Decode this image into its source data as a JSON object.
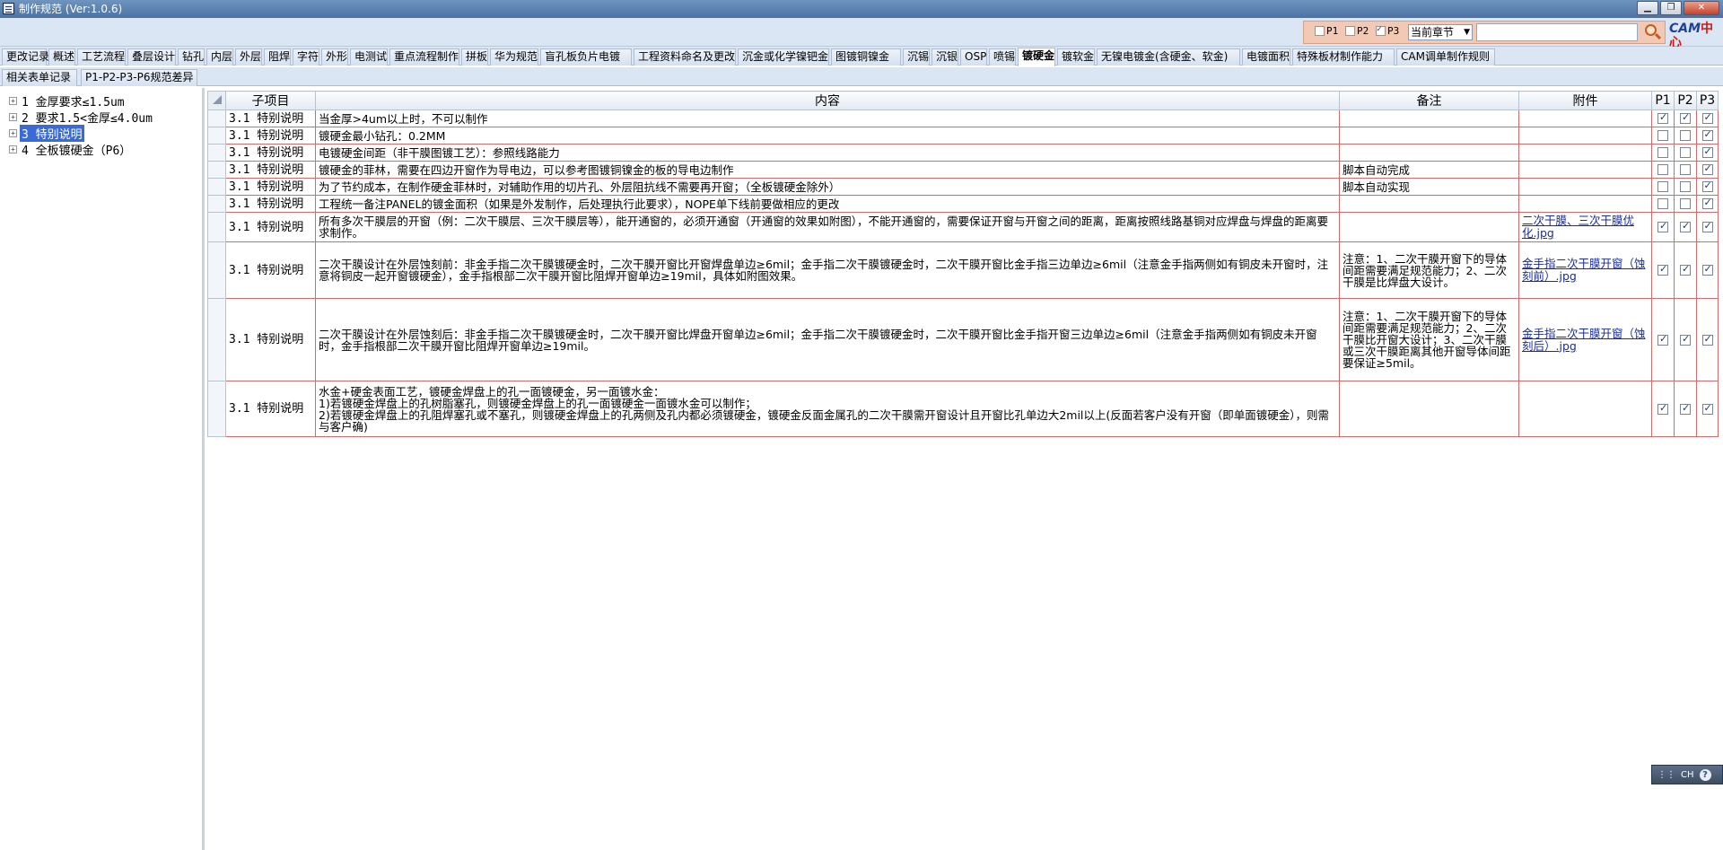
{
  "window": {
    "title": "制作规范 (Ver:1.0.6)"
  },
  "search": {
    "p1_label": "P1",
    "p2_label": "P2",
    "p3_label": "P3",
    "p1_checked": false,
    "p2_checked": false,
    "p3_checked": true,
    "scope_value": "当前章节",
    "query": "",
    "logo_latin": "CAM",
    "logo_zh": "中心"
  },
  "tabs_row1": [
    "更改记录",
    "概述",
    "工艺流程",
    "叠层设计",
    "钻孔",
    "内层",
    "外层",
    "阻焊",
    "字符",
    "外形",
    "电测试",
    "重点流程制作",
    "拼板",
    "华为规范",
    "盲孔板负片电镀",
    "工程资料命名及更改",
    "沉金或化学镍钯金",
    "图镀铜镍金",
    "沉锡",
    "沉银",
    "OSP",
    "喷锡",
    "镀硬金",
    "镀软金",
    "无镍电镀金(含硬金、软金)",
    "电镀面积",
    "特殊板材制作能力",
    "CAM调单制作规则"
  ],
  "active_tab": "镀硬金",
  "tabs_row2": [
    "相关表单记录",
    "P1-P2-P3-P6规范差异"
  ],
  "tree": [
    {
      "label": "1 金厚要求≤1.5um"
    },
    {
      "label": "2 要求1.5<金厚≤4.0um"
    },
    {
      "label": "3 特别说明"
    },
    {
      "label": "4 全板镀硬金（P6）"
    }
  ],
  "selected_tree_index": 2,
  "grid": {
    "headers": {
      "sub": "子项目",
      "content": "内容",
      "note": "备注",
      "attach": "附件",
      "p1": "P1",
      "p2": "P2",
      "p3": "P3"
    },
    "rows": [
      {
        "sub": "3.1 特别说明",
        "content": "当金厚>4um以上时，不可以制作",
        "note": "",
        "attach": "",
        "p1": true,
        "p2": true,
        "p3": true
      },
      {
        "sub": "3.1 特别说明",
        "content": "镀硬金最小钻孔：0.2MM",
        "note": "",
        "attach": "",
        "p1": false,
        "p2": false,
        "p3": true
      },
      {
        "sub": "3.1 特别说明",
        "content": "电镀硬金间距（非干膜图镀工艺）：参照线路能力",
        "note": "",
        "attach": "",
        "p1": false,
        "p2": false,
        "p3": true
      },
      {
        "sub": "3.1 特别说明",
        "content": "镀硬金的菲林，需要在四边开窗作为导电边，可以参考图镀铜镍金的板的导电边制作",
        "note": "脚本自动完成",
        "attach": "",
        "p1": false,
        "p2": false,
        "p3": true
      },
      {
        "sub": "3.1 特别说明",
        "content": "为了节约成本，在制作硬金菲林时，对辅助作用的切片孔、外层阻抗线不需要再开窗；（全板镀硬金除外）",
        "note": "脚本自动实现",
        "attach": "",
        "p1": false,
        "p2": false,
        "p3": true
      },
      {
        "sub": "3.1 特别说明",
        "content": "工程统一备注PANEL的镀金面积（如果是外发制作，后处理执行此要求），NOPE单下线前要做相应的更改",
        "note": "",
        "attach": "",
        "p1": false,
        "p2": false,
        "p3": true
      },
      {
        "sub": "3.1 特别说明",
        "content": "所有多次干膜层的开窗（例：二次干膜层、三次干膜层等），能开通窗的，必须开通窗（开通窗的效果如附图），不能开通窗的，需要保证开窗与开窗之间的距离，距离按照线路基铜对应焊盘与焊盘的距离要求制作。",
        "note": "",
        "attach": "二次干膜、三次干膜优化.jpg",
        "p1": true,
        "p2": true,
        "p3": true
      },
      {
        "sub": "3.1 特别说明",
        "content": "二次干膜设计在外层蚀刻前：非金手指二次干膜镀硬金时，二次干膜开窗比开窗焊盘单边≥6mil；金手指二次干膜镀硬金时，二次干膜开窗比金手指三边单边≥6mil（注意金手指两侧如有铜皮未开窗时，注意将铜皮一起开窗镀硬金），金手指根部二次干膜开窗比阻焊开窗单边≥19mil，具体如附图效果。",
        "note": "注意：1、二次干膜开窗下的导体间距需要满足规范能力；2、二次干膜是比焊盘大设计。",
        "attach": "金手指二次干膜开窗（蚀刻前）.jpg",
        "p1": true,
        "p2": true,
        "p3": true
      },
      {
        "sub": "3.1 特别说明",
        "content": "二次干膜设计在外层蚀刻后：非金手指二次干膜镀硬金时，二次干膜开窗比焊盘开窗单边≥6mil；金手指二次干膜镀硬金时，二次干膜开窗比金手指开窗三边单边≥6mil（注意金手指两侧如有铜皮未开窗时，金手指根部二次干膜开窗比阻焊开窗单边≥19mil。",
        "note": "注意：1、二次干膜开窗下的导体间距需要满足规范能力；2、二次干膜比开窗大设计；3、二次干膜或三次干膜距离其他开窗导体间距要保证≥5mil。",
        "attach": "金手指二次干膜开窗（蚀刻后）.jpg",
        "p1": true,
        "p2": true,
        "p3": true
      },
      {
        "sub": "3.1 特别说明",
        "content": "水金+硬金表面工艺，镀硬金焊盘上的孔一面镀硬金，另一面镀水金：\n1)若镀硬金焊盘上的孔树脂塞孔，则镀硬金焊盘上的孔一面镀硬金一面镀水金可以制作；\n2)若镀硬金焊盘上的孔阻焊塞孔或不塞孔，则镀硬金焊盘上的孔两侧及孔内都必须镀硬金，镀硬金反面金属孔的二次干膜需开窗设计且开窗比孔单边大2mil以上(反面若客户没有开窗（即单面镀硬金），则需与客户确)",
        "note": "",
        "attach": "",
        "p1": true,
        "p2": true,
        "p3": true
      }
    ]
  },
  "ime": {
    "label": "CH",
    "help": "?"
  }
}
